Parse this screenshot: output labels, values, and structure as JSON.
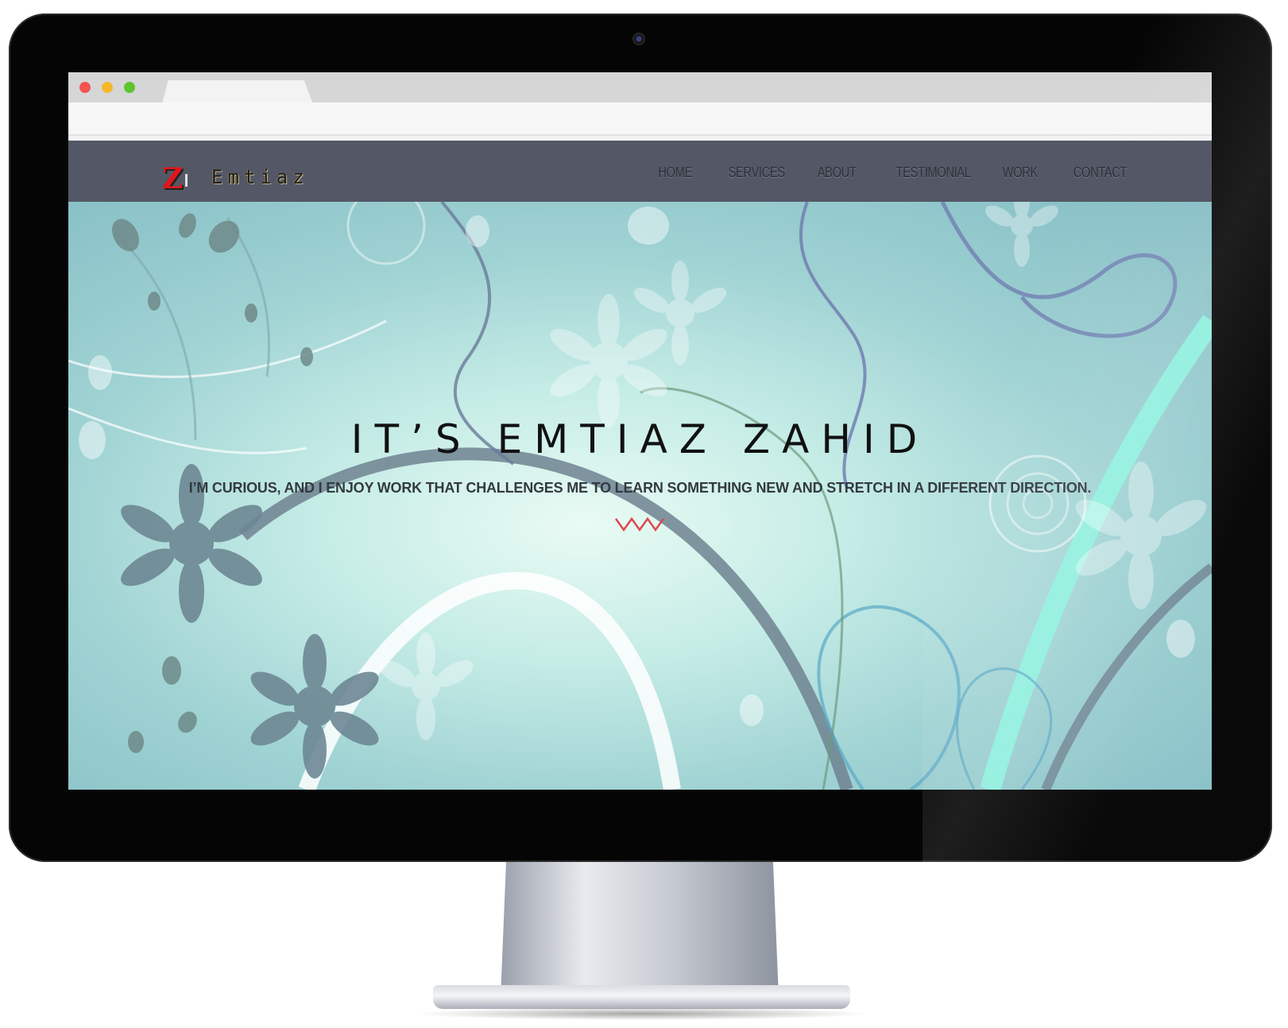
{
  "browser": {
    "traffic_lights": [
      "close",
      "minimize",
      "maximize"
    ],
    "tab_title": ""
  },
  "site": {
    "logo": {
      "mark": "Z",
      "text": "Emtiaz"
    },
    "nav": [
      "HOME",
      "SERVICES",
      "ABOUT",
      "TESTIMONIAL",
      "WORK",
      "CONTACT"
    ],
    "hero": {
      "title": "IT’S EMTIAZ ZAHID",
      "subtitle": "I’M CURIOUS, AND I ENJOY WORK THAT CHALLENGES ME TO LEARN SOMETHING NEW AND STRETCH IN A DIFFERENT DIRECTION.",
      "divider_icon": "zigzag-icon"
    }
  },
  "colors": {
    "navbar": "#545866",
    "logo_mark": "#e0161b",
    "zigzag": "#e0464f",
    "hero_light": "#e9fbf4",
    "hero_dark": "#83bcc4"
  }
}
